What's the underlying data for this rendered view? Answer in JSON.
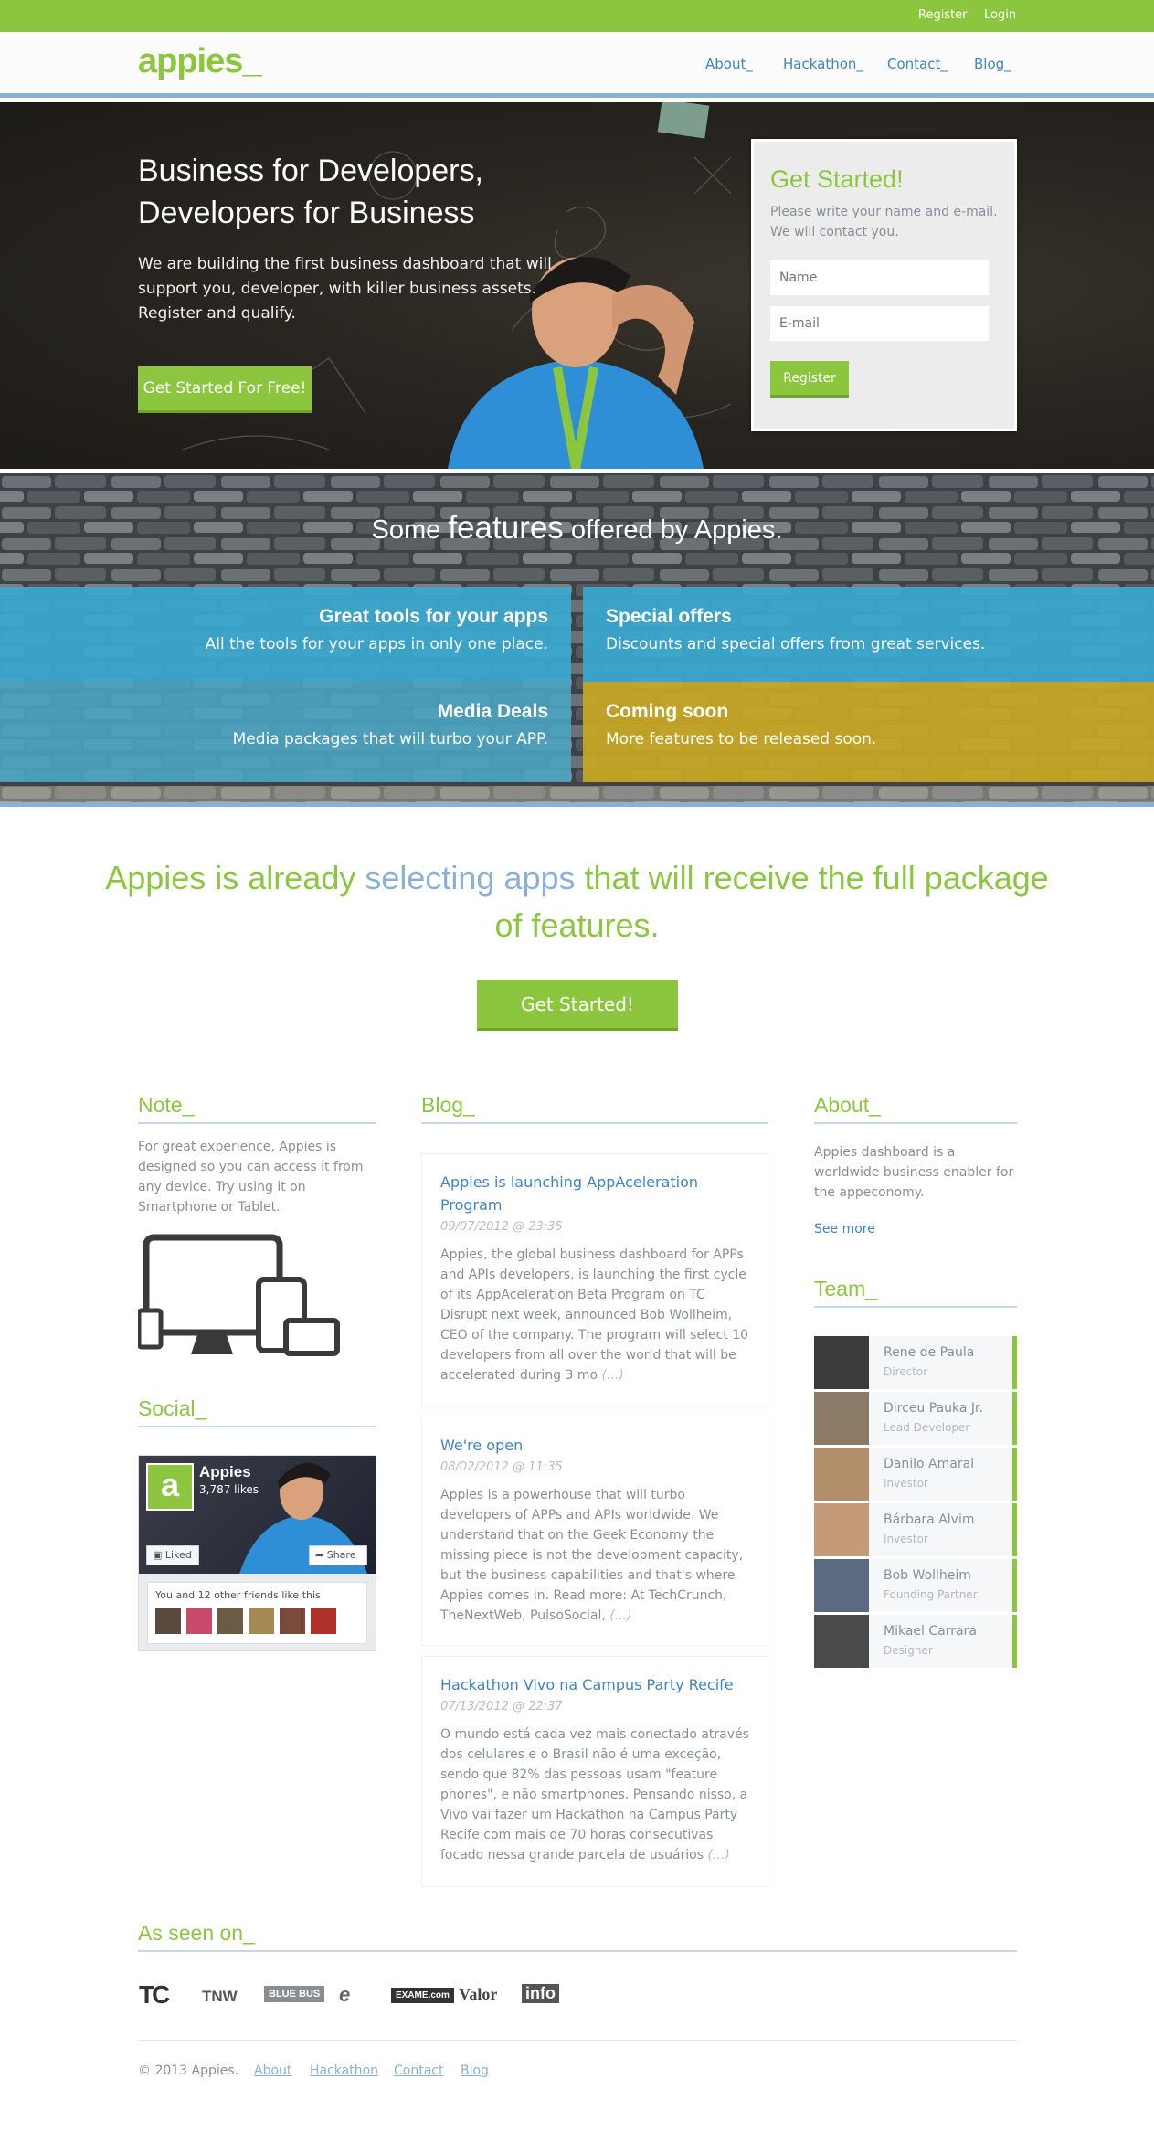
{
  "topbar": {
    "register": "Register",
    "login": "Login"
  },
  "nav": {
    "logo": "appies_",
    "items": [
      "About_",
      "Hackathon_",
      "Contact_",
      "Blog_"
    ]
  },
  "hero": {
    "title": "Business for Developers, Developers for Business",
    "text": "We are building the first business dashboard that will support you, developer, with killer business assets. Register and qualify.",
    "button": "Get Started For Free!"
  },
  "signup": {
    "title": "Get Started!",
    "text": "Please write your name and e-mail. We will contact you.",
    "name_placeholder": "Name",
    "email_placeholder": "E-mail",
    "button": "Register"
  },
  "features": {
    "title_pre": "Some",
    "title_big": "features",
    "title_post": "offered by Appies.",
    "items": [
      {
        "title": "Great tools for your apps",
        "text": "All the tools for your apps in only one place."
      },
      {
        "title": "Special offers",
        "text": "Discounts and special offers from great services."
      },
      {
        "title": "Media Deals",
        "text": "Media packages that will turbo your APP."
      },
      {
        "title": "Coming soon",
        "text": "More features to be released soon."
      }
    ],
    "colors": {
      "blue": "#3aa8d0",
      "yellow": "#c9a723"
    }
  },
  "cta": {
    "text_a": "Appies is already",
    "text_b": "selecting apps",
    "text_c": "that will receive the full package of features.",
    "button": "Get Started!"
  },
  "note": {
    "title": "Note_",
    "text": "For great experience, Appies is designed so you can access it from any device. Try using it on Smartphone or Tablet."
  },
  "social": {
    "title": "Social_",
    "page_name": "Appies",
    "likes": "3,787 likes",
    "liked": "Liked",
    "share": "Share",
    "friends": "You and 12 other friends like this"
  },
  "blog": {
    "title": "Blog_",
    "posts": [
      {
        "title": "Appies is launching AppAceleration Program",
        "date": "09/07/2012 @ 23:35",
        "text": "Appies, the global business dashboard for APPs and APIs developers, is launching the first cycle of its AppAceleration Beta Program on TC Disrupt next week, announced Bob Wollheim, CEO of the company. The program will select 10 developers from all over the world that will be accelerated during 3 mo",
        "more": "(...)"
      },
      {
        "title": "We're open",
        "date": "08/02/2012 @ 11:35",
        "text": "Appies is a powerhouse that will turbo developers of APPs and APIs worldwide. We understand that on the Geek Economy the missing piece is not the development capacity, but the business capabilities and that's where Appies comes in. Read more: At TechCrunch, TheNextWeb, PulsoSocial,",
        "more": "(...)"
      },
      {
        "title": "Hackathon Vivo na Campus Party Recife",
        "date": "07/13/2012 @ 22:37",
        "text": "O mundo está cada vez mais conectado através dos celulares e o Brasil não é uma exceção, sendo que 82% das pessoas usam \"feature phones\", e não smartphones. Pensando nisso, a Vivo vai fazer um Hackathon na Campus Party Recife com mais de 70 horas consecutivas focado nessa grande parcela de usuários",
        "more": "(...)"
      }
    ]
  },
  "about": {
    "title": "About_",
    "text": "Appies dashboard is a worldwide business enabler for the appeconomy.",
    "link": "See more"
  },
  "team": {
    "title": "Team_",
    "members": [
      {
        "name": "Rene de Paula",
        "role": "Director"
      },
      {
        "name": "Dirceu Pauka Jr.",
        "role": "Lead Developer"
      },
      {
        "name": "Danilo Amaral",
        "role": "Investor"
      },
      {
        "name": "Bárbara Alvim",
        "role": "Investor"
      },
      {
        "name": "Bob Wollheim",
        "role": "Founding Partner"
      },
      {
        "name": "Mikael Carrara",
        "role": "Designer"
      }
    ]
  },
  "seen": {
    "title": "As seen on_",
    "logos": [
      "TC",
      "TNW",
      "BLUE BUS",
      "e",
      "EXAME.com",
      "Valor",
      "info"
    ]
  },
  "footer": {
    "copyright": "© 2013 Appies.",
    "links": [
      "About",
      "Hackathon",
      "Contact",
      "Blog"
    ]
  }
}
